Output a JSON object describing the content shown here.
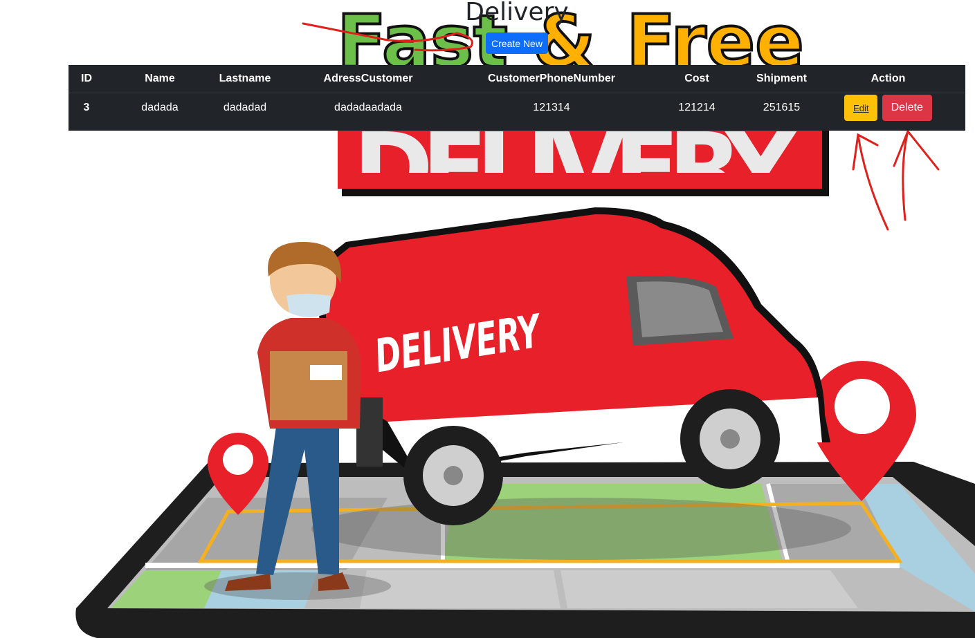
{
  "page": {
    "title": "Delivery"
  },
  "toolbar": {
    "create_label": "Create New"
  },
  "table": {
    "headers": [
      "ID",
      "Name",
      "Lastname",
      "AdressCustomer",
      "CustomerPhoneNumber",
      "Cost",
      "Shipment",
      "Action"
    ],
    "rows": [
      {
        "id": "3",
        "name": "dadada",
        "lastname": "dadadad",
        "address": "dadadaadada",
        "phone": "121314",
        "cost": "121214",
        "shipment": "251615",
        "edit_label": "Edit",
        "delete_label": "Delete"
      }
    ]
  },
  "background": {
    "banner_top_text": "Fast & Free",
    "banner_bottom_text": "DELIVERY",
    "van_text": "DELIVERY",
    "colors": {
      "green": "#6cc04a",
      "orange": "#ffb000",
      "red": "#e8202a",
      "dark": "#212529"
    }
  }
}
